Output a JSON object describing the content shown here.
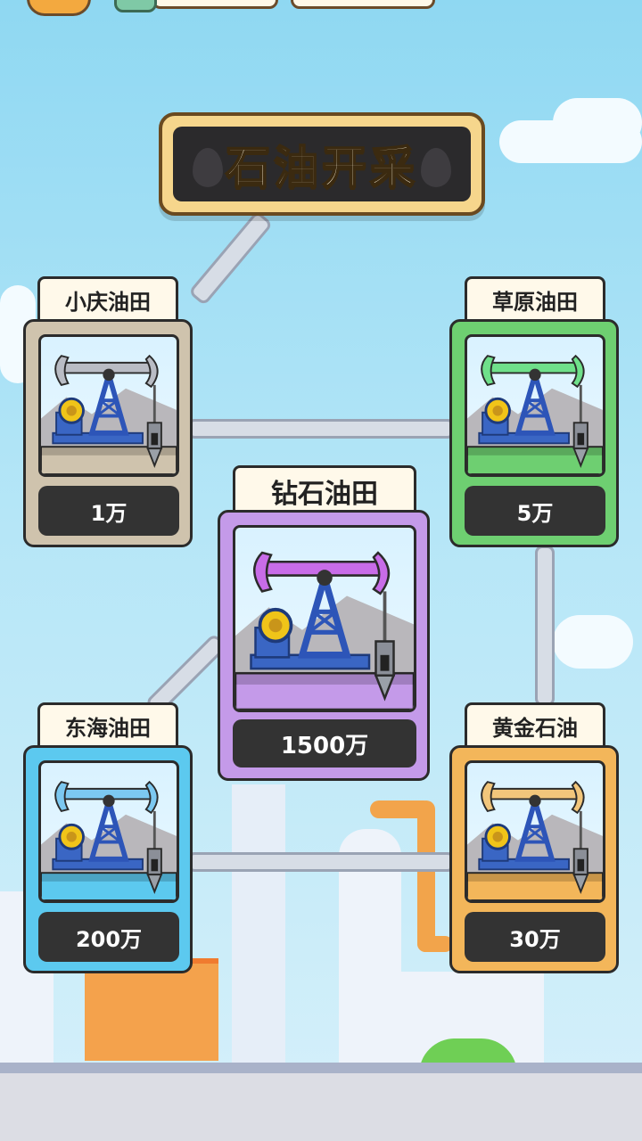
{
  "title": "石油开采",
  "fields": [
    {
      "id": "xiaoqing",
      "name": "小庆油田",
      "price": "1万",
      "color": "#cfc3ad",
      "jack_color": "#b9bcc4"
    },
    {
      "id": "caoyuan",
      "name": "草原油田",
      "price": "5万",
      "color": "#6ecf71",
      "jack_color": "#6fe08a"
    },
    {
      "id": "zuanshi",
      "name": "钻石油田",
      "price": "1500万",
      "color": "#c49ae9",
      "jack_color": "#c86ce8"
    },
    {
      "id": "donghai",
      "name": "东海油田",
      "price": "200万",
      "color": "#5cc9ef",
      "jack_color": "#7cc8f0"
    },
    {
      "id": "huangjin",
      "name": "黄金石油",
      "price": "30万",
      "color": "#f3b65a",
      "jack_color": "#f2c67b"
    }
  ],
  "icons": {
    "title_decoration": "oil-drop-icon",
    "pump": "pumpjack-icon"
  }
}
